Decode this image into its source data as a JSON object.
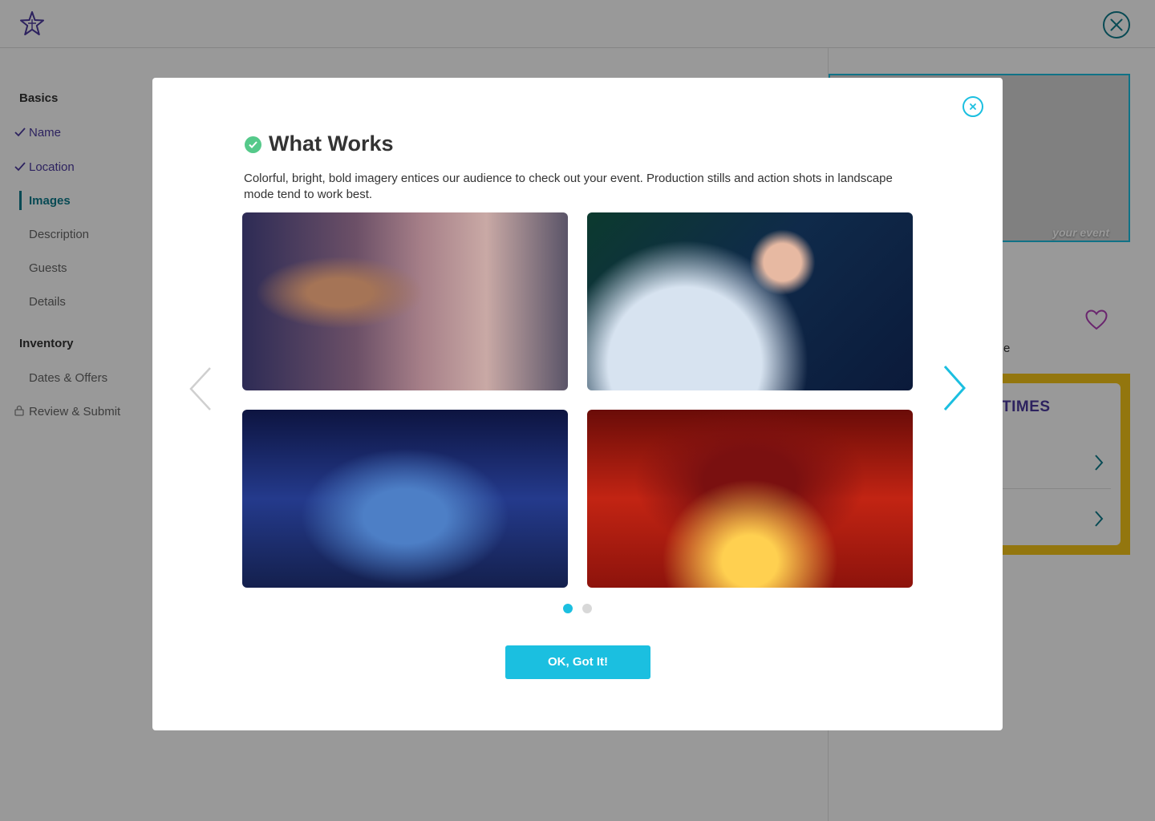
{
  "sidebar": {
    "sections": [
      {
        "label": "Basics"
      },
      {
        "label": "Inventory"
      }
    ],
    "items": [
      {
        "label": "Name"
      },
      {
        "label": "Location"
      },
      {
        "label": "Images"
      },
      {
        "label": "Description"
      },
      {
        "label": "Guests"
      },
      {
        "label": "Details"
      },
      {
        "label": "Dates & Offers"
      },
      {
        "label": "Review & Submit"
      }
    ]
  },
  "preview": {
    "image_caption": "your event",
    "fragment_text": "e",
    "times_heading": "TIMES"
  },
  "modal": {
    "title": "What Works",
    "description": "Colorful, bright, bold imagery entices our audience to check out your event. Production stills and action shots in landscape mode tend to work best.",
    "ok_label": "OK, Got It!",
    "active_page": 1,
    "page_count": 2
  },
  "colors": {
    "accent": "#1bbfe0",
    "brand_purple": "#4b3a9e",
    "success_green": "#55c98a",
    "active_teal": "#0e7c8c"
  },
  "icons": {
    "logo": "star-logo-icon",
    "close": "close-circle-icon",
    "check": "check-icon",
    "lock": "lock-icon",
    "heart": "heart-icon",
    "prev": "chevron-left-icon",
    "next": "chevron-right-icon"
  }
}
